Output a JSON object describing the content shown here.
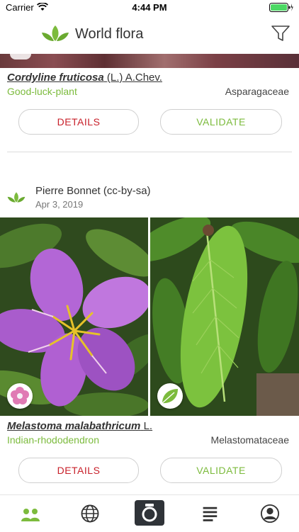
{
  "status": {
    "carrier": "Carrier",
    "time": "4:44 PM"
  },
  "nav": {
    "title": "World flora"
  },
  "cards": [
    {
      "genus_species": "Cordyline fruticosa",
      "author": "(L.) A.Chev.",
      "common_name": "Good-luck-plant",
      "family": "Asparagaceae",
      "details_label": "DETAILS",
      "validate_label": "VALIDATE"
    },
    {
      "observer": "Pierre Bonnet (cc-by-sa)",
      "date": "Apr 3, 2019",
      "organs": [
        "flower-icon",
        "leaf-icon"
      ],
      "genus_species": "Melastoma malabathricum",
      "author": "L.",
      "common_name": "Indian-rhododendron",
      "family": "Melastomataceae",
      "details_label": "DETAILS",
      "validate_label": "VALIDATE"
    }
  ],
  "tabs": [
    "observations-icon",
    "globe-icon",
    "camera-icon",
    "list-icon",
    "profile-icon"
  ],
  "colors": {
    "accent_green": "#7cbb3d",
    "details_red": "#c8202a",
    "camera_dark": "#2f3338"
  }
}
